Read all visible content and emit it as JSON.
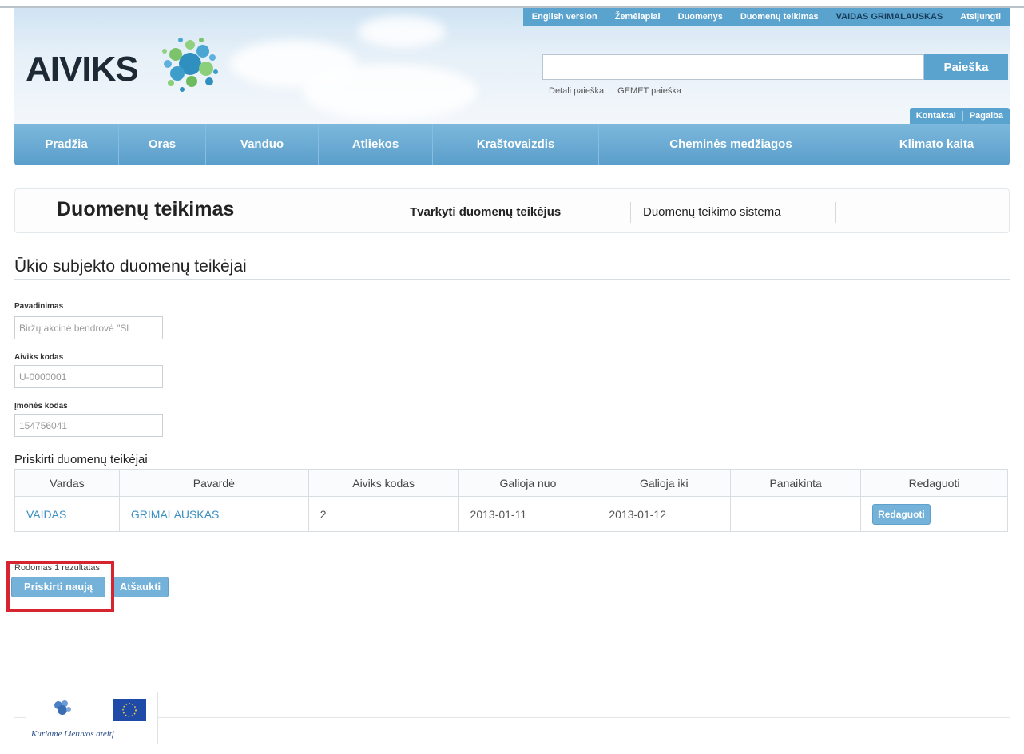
{
  "header": {
    "logo_text": "AIVIKS",
    "top_nav": [
      "English version",
      "Žemėlapiai",
      "Duomenys",
      "Duomenų teikimas"
    ],
    "user_name": "VAIDAS GRIMALAUSKAS",
    "logout_label": "Atsijungti",
    "search_button": "Paieška",
    "search_value": "",
    "search_links": [
      "Detali paieška",
      "GEMET paieška"
    ],
    "right_links": [
      "Kontaktai",
      "Pagalba"
    ]
  },
  "main_menu": [
    "Pradžia",
    "Oras",
    "Vanduo",
    "Atliekos",
    "Kraštovaizdis",
    "Cheminės medžiagos",
    "Klimato kaita"
  ],
  "subheader": {
    "title": "Duomenų teikimas",
    "tabs": [
      "Tvarkyti duomenų teikėjus",
      "Duomenų teikimo sistema"
    ],
    "active_tab": "Tvarkyti duomenų teikėjus"
  },
  "section": {
    "title": "Ūkio subjekto duomenų teikėjai",
    "fields": [
      {
        "label": "Pavadinimas",
        "value": "Biržų akcinė bendrovė \"Sl"
      },
      {
        "label": "Aiviks kodas",
        "value": "U-0000001"
      },
      {
        "label": "Įmonės kodas",
        "value": "154756041"
      }
    ]
  },
  "table": {
    "title": "Priskirti duomenų teikėjai",
    "headers": [
      "Vardas",
      "Pavardė",
      "Aiviks kodas",
      "Galioja nuo",
      "Galioja iki",
      "Panaikinta",
      "Redaguoti"
    ],
    "rows": [
      {
        "vardas": "VAIDAS",
        "pavarde": "GRIMALAUSKAS",
        "aiviks_kodas": "2",
        "galioja_nuo": "2013-01-11",
        "galioja_iki": "2013-01-12",
        "panaikinta": "",
        "edit_label": "Redaguoti"
      }
    ]
  },
  "records_text": "Rodomas 1 rezultatas.",
  "actions": {
    "assign_new": "Priskirti naują",
    "cancel": "Atšaukti"
  },
  "footer": {
    "caption": "Kuriame Lietuvos ateitį"
  },
  "colors": {
    "accent": "#5aa3cf",
    "highlight": "#d62430",
    "link": "#3b8fc1"
  }
}
